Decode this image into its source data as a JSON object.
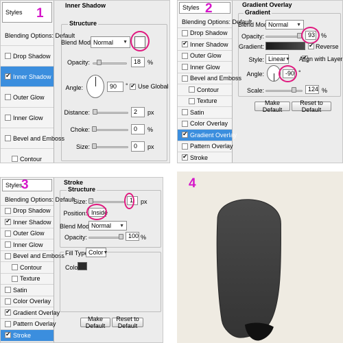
{
  "colors": {
    "highlight_circle": "#e0197f",
    "number_tag": "#d516c9",
    "selected_item": "#3b8ede",
    "canvas_bg": "#efebe2",
    "shape_fill": "#3f3f3f"
  },
  "panel1": {
    "number": "1",
    "styles_header": "Styles",
    "items": [
      {
        "label": "Blending Options: Default",
        "checkbox": false
      },
      {
        "label": "Drop Shadow",
        "checkbox": true,
        "checked": false
      },
      {
        "label": "Inner Shadow",
        "checkbox": true,
        "checked": true,
        "selected": true
      },
      {
        "label": "Outer Glow",
        "checkbox": true,
        "checked": false
      },
      {
        "label": "Inner Glow",
        "checkbox": true,
        "checked": false
      },
      {
        "label": "Bevel and Emboss",
        "checkbox": true,
        "checked": false
      },
      {
        "label": "Contour",
        "checkbox": true,
        "checked": false,
        "sub": true
      }
    ],
    "group_title": "Inner Shadow",
    "legend": "Structure",
    "blend_mode_label": "Blend Mode:",
    "blend_mode": "Normal",
    "opacity_label": "Opacity:",
    "opacity": "18",
    "opacity_unit": "%",
    "angle_label": "Angle:",
    "angle": "90",
    "angle_unit": "°",
    "use_global_light": "Use Global Light",
    "distance_label": "Distance:",
    "distance": "2",
    "distance_unit": "px",
    "choke_label": "Choke:",
    "choke": "0",
    "choke_unit": "%",
    "size_label": "Size:",
    "size": "0",
    "size_unit": "px"
  },
  "panel2": {
    "number": "2",
    "styles_header": "Styles",
    "items": [
      {
        "label": "Blending Options: Default",
        "checkbox": false
      },
      {
        "label": "Drop Shadow",
        "checkbox": true,
        "checked": false
      },
      {
        "label": "Inner Shadow",
        "checkbox": true,
        "checked": true
      },
      {
        "label": "Outer Glow",
        "checkbox": true,
        "checked": false
      },
      {
        "label": "Inner Glow",
        "checkbox": true,
        "checked": false
      },
      {
        "label": "Bevel and Emboss",
        "checkbox": true,
        "checked": false
      },
      {
        "label": "Contour",
        "checkbox": true,
        "checked": false,
        "sub": true
      },
      {
        "label": "Texture",
        "checkbox": true,
        "checked": false,
        "sub": true
      },
      {
        "label": "Satin",
        "checkbox": true,
        "checked": false
      },
      {
        "label": "Color Overlay",
        "checkbox": true,
        "checked": false
      },
      {
        "label": "Gradient Overlay",
        "checkbox": true,
        "checked": true,
        "selected": true
      },
      {
        "label": "Pattern Overlay",
        "checkbox": true,
        "checked": false
      },
      {
        "label": "Stroke",
        "checkbox": true,
        "checked": true
      }
    ],
    "group_title": "Gradient Overlay",
    "legend": "Gradient",
    "blend_mode_label": "Blend Mode:",
    "blend_mode": "Normal",
    "opacity_label": "Opacity:",
    "opacity": "93",
    "opacity_unit": "%",
    "gradient_label": "Gradient:",
    "reverse": "Reverse",
    "style_label": "Style:",
    "style": "Linear",
    "align_with_layer": "Align with Layer",
    "angle_label": "Angle:",
    "angle": "-90",
    "angle_unit": "°",
    "scale_label": "Scale:",
    "scale": "124",
    "scale_unit": "%",
    "make_default": "Make Default",
    "reset_to_default": "Reset to Default"
  },
  "panel3": {
    "number": "3",
    "styles_header": "Styles",
    "items": [
      {
        "label": "Blending Options: Default",
        "checkbox": false
      },
      {
        "label": "Drop Shadow",
        "checkbox": true,
        "checked": false
      },
      {
        "label": "Inner Shadow",
        "checkbox": true,
        "checked": true
      },
      {
        "label": "Outer Glow",
        "checkbox": true,
        "checked": false
      },
      {
        "label": "Inner Glow",
        "checkbox": true,
        "checked": false
      },
      {
        "label": "Bevel and Emboss",
        "checkbox": true,
        "checked": false
      },
      {
        "label": "Contour",
        "checkbox": true,
        "checked": false,
        "sub": true
      },
      {
        "label": "Texture",
        "checkbox": true,
        "checked": false,
        "sub": true
      },
      {
        "label": "Satin",
        "checkbox": true,
        "checked": false
      },
      {
        "label": "Color Overlay",
        "checkbox": true,
        "checked": false
      },
      {
        "label": "Gradient Overlay",
        "checkbox": true,
        "checked": true
      },
      {
        "label": "Pattern Overlay",
        "checkbox": true,
        "checked": false
      },
      {
        "label": "Stroke",
        "checkbox": true,
        "checked": true,
        "selected": true
      }
    ],
    "group_title": "Stroke",
    "legend": "Structure",
    "size_label": "Size:",
    "size": "1",
    "size_unit": "px",
    "position_label": "Position:",
    "position": "Inside",
    "blend_mode_label": "Blend Mode:",
    "blend_mode": "Normal",
    "opacity_label": "Opacity:",
    "opacity": "100",
    "opacity_unit": "%",
    "fill_type_label": "Fill Type:",
    "fill_type": "Color",
    "color_label": "Color:",
    "make_default": "Make Default",
    "reset_to_default": "Reset to Default"
  },
  "panel4": {
    "number": "4"
  }
}
